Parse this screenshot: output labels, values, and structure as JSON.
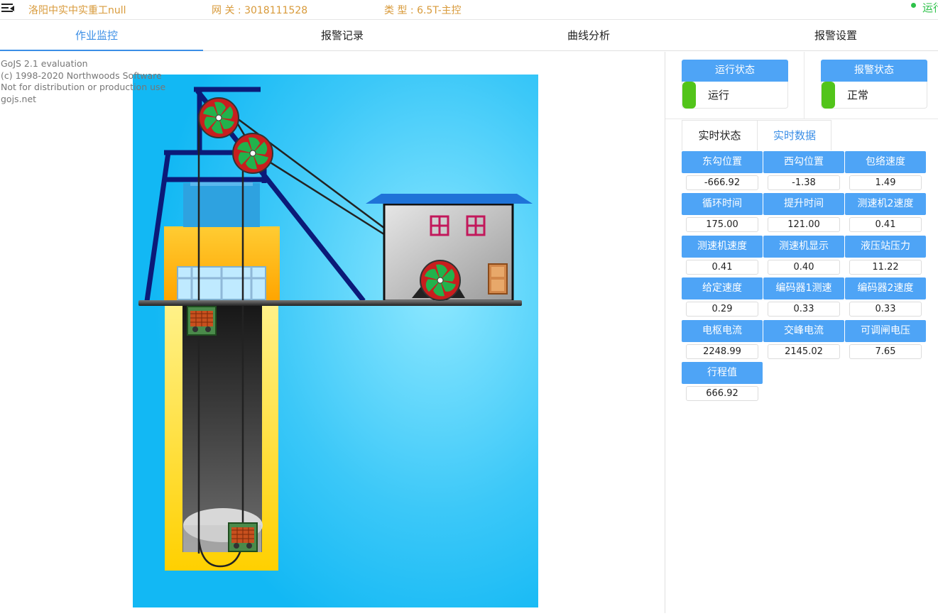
{
  "header": {
    "company": "洛阳中实中实重工null",
    "gateway": "网 关 : 3018111528",
    "type": "类 型 : 6.5T-主控",
    "run_status": "运行"
  },
  "tabs": [
    {
      "label": "作业监控"
    },
    {
      "label": "报警记录"
    },
    {
      "label": "曲线分析"
    },
    {
      "label": "报警设置"
    }
  ],
  "gojs_notice": "GoJS 2.1 evaluation\n(c) 1998-2020 Northwoods Software\nNot for distribution or production use\ngojs.net",
  "run_box": {
    "title": "运行状态",
    "value": "运行"
  },
  "alarm_box": {
    "title": "报警状态",
    "value": "正常"
  },
  "subtabs": [
    {
      "label": "实时状态"
    },
    {
      "label": "实时数据"
    }
  ],
  "realtime": [
    {
      "label": "东勾位置",
      "value": "-666.92"
    },
    {
      "label": "西勾位置",
      "value": "-1.38"
    },
    {
      "label": "包络速度",
      "value": "1.49"
    },
    {
      "label": "循环时间",
      "value": "175.00"
    },
    {
      "label": "提升时间",
      "value": "121.00"
    },
    {
      "label": "测速机2速度",
      "value": "0.41"
    },
    {
      "label": "测速机速度",
      "value": "0.41"
    },
    {
      "label": "测速机显示",
      "value": "0.40"
    },
    {
      "label": "液压站压力",
      "value": "11.22"
    },
    {
      "label": "给定速度",
      "value": "0.29"
    },
    {
      "label": "编码器1测速",
      "value": "0.33"
    },
    {
      "label": "编码器2速度",
      "value": "0.33"
    },
    {
      "label": "电枢电流",
      "value": "2248.99"
    },
    {
      "label": "交峰电流",
      "value": "2145.02"
    },
    {
      "label": "可调闸电压",
      "value": "7.65"
    },
    {
      "label": "行程值",
      "value": "666.92"
    }
  ],
  "colors": {
    "accent": "#3a8ee6",
    "label_bg": "#4ea4f6",
    "ok_green": "#52c41a",
    "header_text": "#d89a3a"
  }
}
